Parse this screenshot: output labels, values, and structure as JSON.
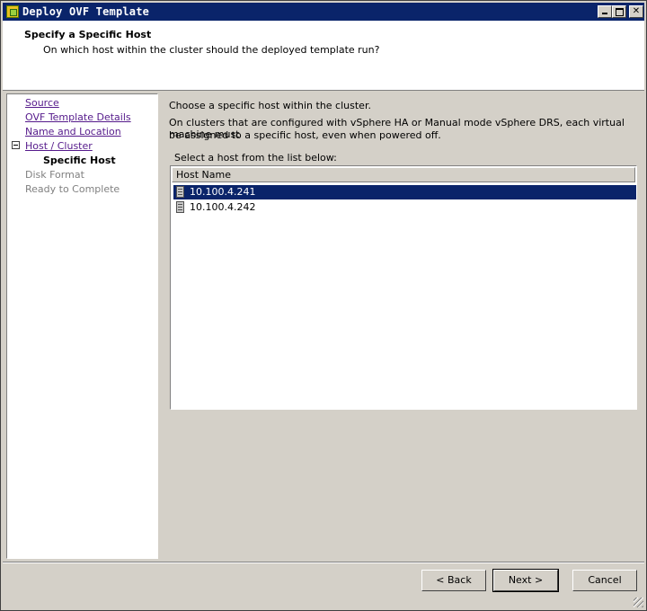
{
  "window": {
    "title": "Deploy OVF Template",
    "controls": {
      "minimize": "",
      "maximize": "",
      "close": "✕"
    }
  },
  "header": {
    "title": "Specify a Specific Host",
    "subtitle": "On which host within the cluster should the deployed template run?"
  },
  "sidebar": {
    "items": [
      {
        "label": "Source",
        "state": "link"
      },
      {
        "label": "OVF Template Details",
        "state": "link"
      },
      {
        "label": "Name and Location",
        "state": "link"
      },
      {
        "label": "Host / Cluster",
        "state": "link"
      },
      {
        "label": "Specific Host",
        "state": "active"
      },
      {
        "label": "Disk Format",
        "state": "disabled"
      },
      {
        "label": "Ready to Complete",
        "state": "disabled"
      }
    ]
  },
  "content": {
    "intro": "Choose a specific host within the cluster.",
    "description_line1": "On clusters that are configured with vSphere HA or Manual mode vSphere DRS, each virtual machine must",
    "description_line2": "be assigned to a specific host, even when powered off.",
    "list_label": "Select a host from the list below:",
    "column_header": "Host Name",
    "hosts": [
      {
        "name": "10.100.4.241",
        "selected": true
      },
      {
        "name": "10.100.4.242",
        "selected": false
      }
    ]
  },
  "footer": {
    "back_label": "< Back",
    "next_label": "Next >",
    "cancel_label": "Cancel"
  },
  "colors": {
    "title_bar": "#0a246a",
    "selection": "#0a246a",
    "link": "#551a8b",
    "window_bg": "#d4d0c8"
  }
}
